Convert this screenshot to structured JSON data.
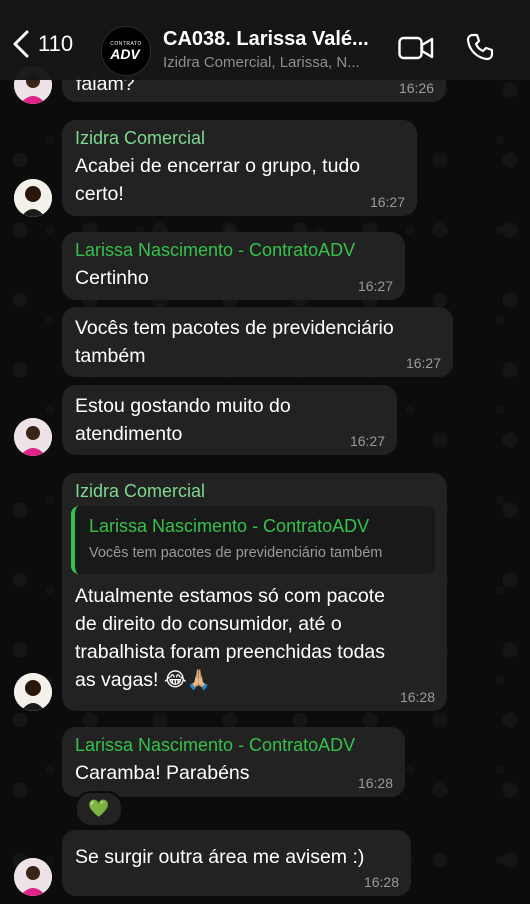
{
  "header": {
    "back_count": "110",
    "title": "CA038. Larissa Valé...",
    "subtitle": "Izidra Comercial, Larissa, N...",
    "avatar_logo_top": "CONTRATO",
    "avatar_logo_main": "ADV",
    "icons": [
      "video-call-icon",
      "voice-call-icon"
    ]
  },
  "messages": [
    {
      "sender": "",
      "text": "falam?",
      "time": "16:26"
    },
    {
      "sender": "Izidra Comercial",
      "text": "Acabei de encerrar o grupo, tudo\ncerto!",
      "time": "16:27"
    },
    {
      "sender": "Larissa Nascimento - ContratoADV",
      "text": "Certinho",
      "time": "16:27"
    },
    {
      "sender": "",
      "text": "Vocês tem pacotes de previdenciário\ntambém",
      "time": "16:27"
    },
    {
      "sender": "",
      "text": "Estou gostando muito do\natendimento",
      "time": "16:27"
    },
    {
      "sender": "Izidra Comercial",
      "quote_sender": "Larissa Nascimento - ContratoADV",
      "quote_text": "Vocês tem pacotes de previdenciário também",
      "text": "Atualmente estamos só com pacote\nde direito do consumidor, até o\ntrabalhista foram preenchidas todas\nas vagas! 😂🙏🏼",
      "time": "16:28"
    },
    {
      "sender": "Larissa Nascimento - ContratoADV",
      "text": "Caramba! Parabéns",
      "time": "16:28",
      "reaction": "💚"
    },
    {
      "sender": "",
      "text": "Se surgir outra área me avisem :)",
      "time": "16:28"
    }
  ],
  "colors": {
    "izidra_name": "#7dd990",
    "larissa_name": "#36c24a",
    "bubble": "#222222",
    "background": "#0c0c0c"
  }
}
